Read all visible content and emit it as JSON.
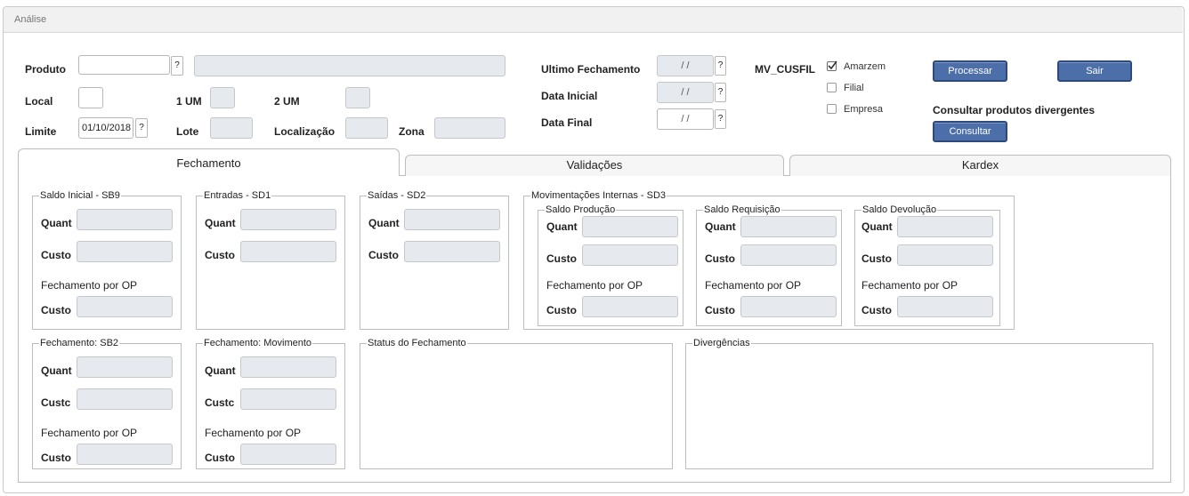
{
  "window": {
    "title": "Análise"
  },
  "form": {
    "produto_label": "Produto",
    "produto_value": "",
    "local_label": "Local",
    "um1_label": "1 UM",
    "um2_label": "2 UM",
    "limite_label": "Limite",
    "limite_value": "01/10/2018",
    "lote_label": "Lote",
    "localizacao_label": "Localização",
    "zona_label": "Zona",
    "lookup_label": "?",
    "ultimo_fechamento_label": "Ultimo Fechamento",
    "ultimo_fechamento_value": " / /",
    "data_inicial_label": "Data Inicial",
    "data_inicial_value": " / /",
    "data_final_label": "Data Final",
    "data_final_value": " / /",
    "mv_cusfil_label": "MV_CUSFIL",
    "options": [
      {
        "label": "Amarzem",
        "checked": true
      },
      {
        "label": "Filial",
        "checked": false
      },
      {
        "label": "Empresa",
        "checked": false
      }
    ],
    "processar_label": "Processar",
    "sair_label": "Sair",
    "consultar_heading": "Consultar produtos divergentes",
    "consultar_label": "Consultar"
  },
  "tabs": [
    {
      "label": "Fechamento",
      "active": true
    },
    {
      "label": "Validações",
      "active": false
    },
    {
      "label": "Kardex",
      "active": false
    }
  ],
  "labels": {
    "quant": "Quant",
    "custo": "Custo",
    "custo_clipped": "Custc",
    "fechamento_op": "Fechamento por OP"
  },
  "groups": {
    "saldo_inicial": "Saldo Inicial - SB9",
    "entradas": "Entradas - SD1",
    "saidas": "Saídas - SD2",
    "mov_internas": "Movimentações Internas - SD3",
    "saldo_producao": "Saldo Produção",
    "saldo_requisicao": "Saldo Requisição",
    "saldo_devolucao": "Saldo Devolução",
    "fechamento_sb2": "Fechamento: SB2",
    "fechamento_movimento": "Fechamento: Movimento",
    "status_fechamento": "Status do Fechamento",
    "divergencias": "Divergências"
  },
  "colors": {
    "button": "#4d6fa9",
    "field": "#e6e9ee"
  }
}
